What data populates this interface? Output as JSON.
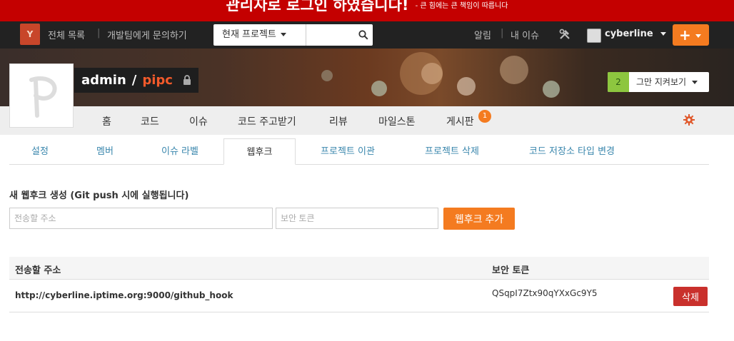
{
  "banner": {
    "message": "관리자로 로그인 하였습니다!",
    "sub": "- 큰 힘에는 큰 책임이 따릅니다"
  },
  "topnav": {
    "logo": "Y",
    "all_list": "전체 목록",
    "contact": "개발팀에게 문의하기",
    "search_scope": "현재 프로젝트",
    "search_value": "",
    "alerts": "알림",
    "my_issues": "내 이슈",
    "username": "cyberline",
    "plus_label": "+"
  },
  "project": {
    "owner": "admin",
    "separator": "/",
    "name": "pipc",
    "watch_count": "2",
    "watch_label": "그만 지켜보기"
  },
  "project_nav": [
    {
      "label": "홈"
    },
    {
      "label": "코드"
    },
    {
      "label": "이슈"
    },
    {
      "label": "코드 주고받기"
    },
    {
      "label": "리뷰"
    },
    {
      "label": "마일스톤"
    },
    {
      "label": "게시판"
    }
  ],
  "board_badge": "1",
  "settings_tabs": [
    {
      "label": "설정"
    },
    {
      "label": "멤버"
    },
    {
      "label": "이슈 라벨"
    },
    {
      "label": "웹후크"
    },
    {
      "label": "프로젝트 이관"
    },
    {
      "label": "프로젝트 삭제"
    },
    {
      "label": "코드 저장소 타입 변경"
    }
  ],
  "active_tab": "웹후크",
  "form": {
    "title": "새 웹후크 생성 (Git push 시에 실행됩니다)",
    "url_placeholder": "전송할 주소",
    "token_placeholder": "보안 토큰",
    "add_label": "웹후크 추가"
  },
  "table": {
    "headers": [
      "전송할 주소",
      "보안 토큰"
    ],
    "rows": [
      {
        "url": "http://cyberline.iptime.org:9000/github_hook",
        "token": "QSqpI7Ztx90qYXxGc9Y5",
        "delete_label": "삭제"
      }
    ]
  },
  "colors": {
    "banner": "#c40000",
    "accent": "#f47b20",
    "project_name": "#f25a2b",
    "link": "#3a87ad",
    "danger": "#c9302c",
    "watch_count_bg": "#8dc63f"
  }
}
